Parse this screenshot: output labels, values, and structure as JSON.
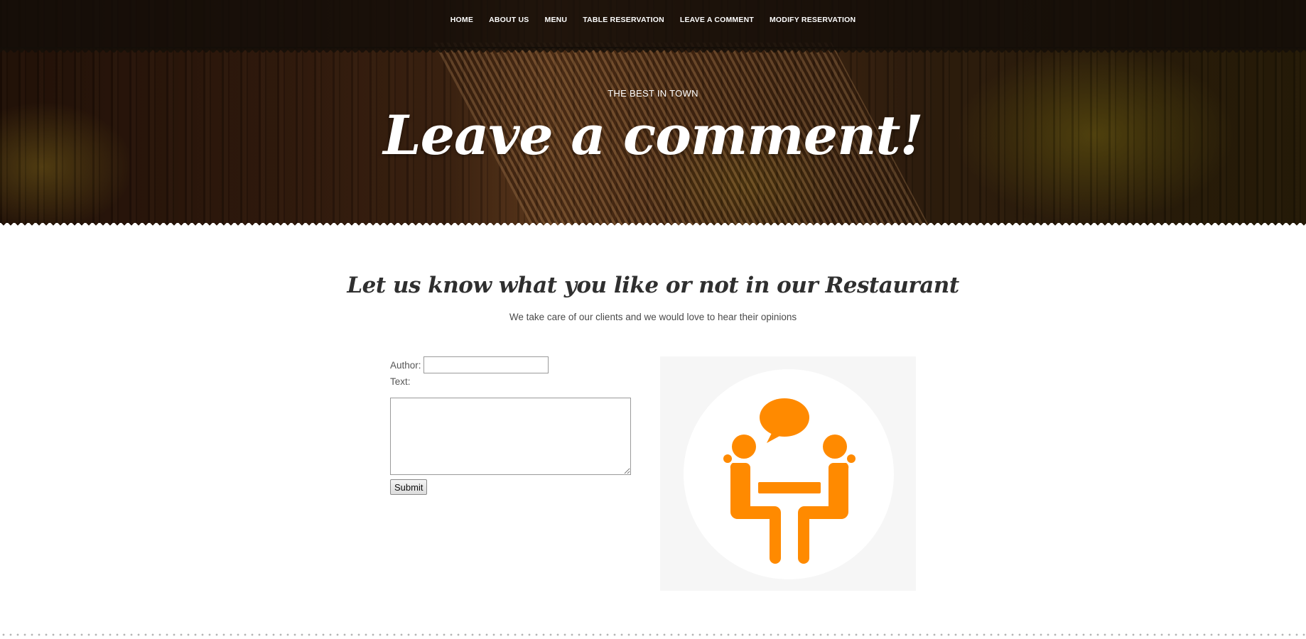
{
  "nav": {
    "items": [
      {
        "label": "HOME"
      },
      {
        "label": "ABOUT US"
      },
      {
        "label": "MENU"
      },
      {
        "label": "TABLE RESERVATION"
      },
      {
        "label": "LEAVE A COMMENT"
      },
      {
        "label": "MODIFY RESERVATION"
      }
    ]
  },
  "hero": {
    "subtitle": "THE BEST IN TOWN",
    "title": "Leave a comment!"
  },
  "section": {
    "title": "Let us know what you like or not in our Restaurant",
    "description": "We take care of our clients and we would love to hear their opinions"
  },
  "form": {
    "author_label": "Author:",
    "author_value": "",
    "text_label": "Text:",
    "text_value": "",
    "submit_label": "Submit"
  },
  "illustration": {
    "icon": "two-people-conversation-icon",
    "accent": "#ff8a00",
    "circle": "#ffffff",
    "panel": "#f6f6f6"
  }
}
